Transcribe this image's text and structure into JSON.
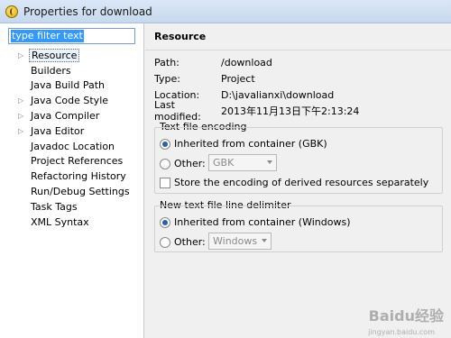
{
  "window": {
    "title": "Properties for download"
  },
  "filter": {
    "placeholder": "type filter text"
  },
  "tree": [
    {
      "label": "Resource",
      "expandable": true,
      "selected": true
    },
    {
      "label": "Builders",
      "expandable": false
    },
    {
      "label": "Java Build Path",
      "expandable": false
    },
    {
      "label": "Java Code Style",
      "expandable": true
    },
    {
      "label": "Java Compiler",
      "expandable": true
    },
    {
      "label": "Java Editor",
      "expandable": true
    },
    {
      "label": "Javadoc Location",
      "expandable": false
    },
    {
      "label": "Project References",
      "expandable": false
    },
    {
      "label": "Refactoring History",
      "expandable": false
    },
    {
      "label": "Run/Debug Settings",
      "expandable": false
    },
    {
      "label": "Task Tags",
      "expandable": false
    },
    {
      "label": "XML Syntax",
      "expandable": false
    }
  ],
  "panel": {
    "header": "Resource",
    "props": [
      {
        "key": "Path:",
        "value": "/download"
      },
      {
        "key": "Type:",
        "value": "Project"
      },
      {
        "key": "Location:",
        "value": "D:\\javalianxi\\download"
      },
      {
        "key": "Last modified:",
        "value": "2013年11月13日下午2:13:24"
      }
    ],
    "encoding": {
      "title": "Text file encoding",
      "inherited_label": "Inherited from container (GBK)",
      "other_label": "Other:",
      "other_value": "GBK",
      "store_label": "Store the encoding of derived resources separately"
    },
    "delimiter": {
      "title": "New text file line delimiter",
      "inherited_label": "Inherited from container (Windows)",
      "other_label": "Other:",
      "other_value": "Windows"
    }
  },
  "watermark": {
    "text": "Baidu经验",
    "sub": "jingyan.baidu.com"
  }
}
